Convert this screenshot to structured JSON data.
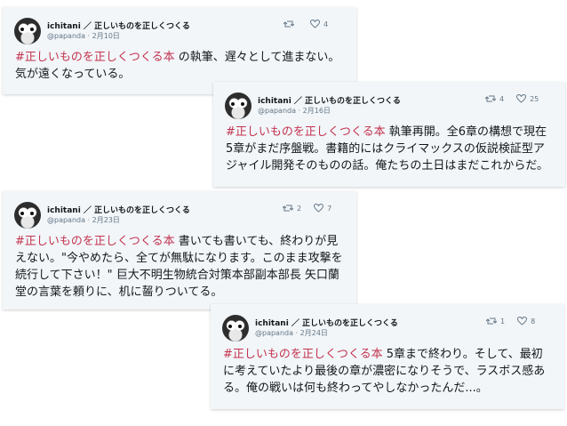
{
  "tweets": [
    {
      "display_name": "ichitani ／ 正しいものを正しくつくる",
      "handle": "@papanda",
      "date": "2月10日",
      "retweets": "",
      "likes": "4",
      "hashtag": "#正しいものを正しくつくる本",
      "text": " の執筆、遅々として進まない。気が遠くなっている。"
    },
    {
      "display_name": "ichitani ／ 正しいものを正しくつくる",
      "handle": "@papanda",
      "date": "2月16日",
      "retweets": "4",
      "likes": "25",
      "hashtag": "#正しいものを正しくつくる本",
      "text": " 執筆再開。全6章の構想で現在5章がまだ序盤戦。書籍的にはクライマックスの仮説検証型アジャイル開発そのものの話。俺たちの土日はまだこれからだ。"
    },
    {
      "display_name": "ichitani ／ 正しいものを正しくつくる",
      "handle": "@papanda",
      "date": "2月23日",
      "retweets": "2",
      "likes": "7",
      "hashtag": "#正しいものを正しくつくる本",
      "text": " 書いても書いても、終わりが見えない。\"今やめたら、全てが無駄になります。このまま攻撃を続行して下さい！\" 巨大不明生物統合対策本部副本部長 矢口蘭堂の言葉を頼りに、机に齧りついてる。"
    },
    {
      "display_name": "ichitani ／ 正しいものを正しくつくる",
      "handle": "@papanda",
      "date": "2月24日",
      "retweets": "1",
      "likes": "8",
      "hashtag": "#正しいものを正しくつくる本",
      "text": " 5章まで終わり。そして、最初に考えていたより最後の章が濃密になりそうで、ラスボス感ある。俺の戦いは何も終わってやしなかったんだ...。"
    }
  ],
  "separator": " · ",
  "colors": {
    "card_bg": "#f2f6f9",
    "hashtag": "#c4334f",
    "muted": "#657786"
  },
  "icons": {
    "retweet": "retweet-icon",
    "like": "heart-icon"
  }
}
